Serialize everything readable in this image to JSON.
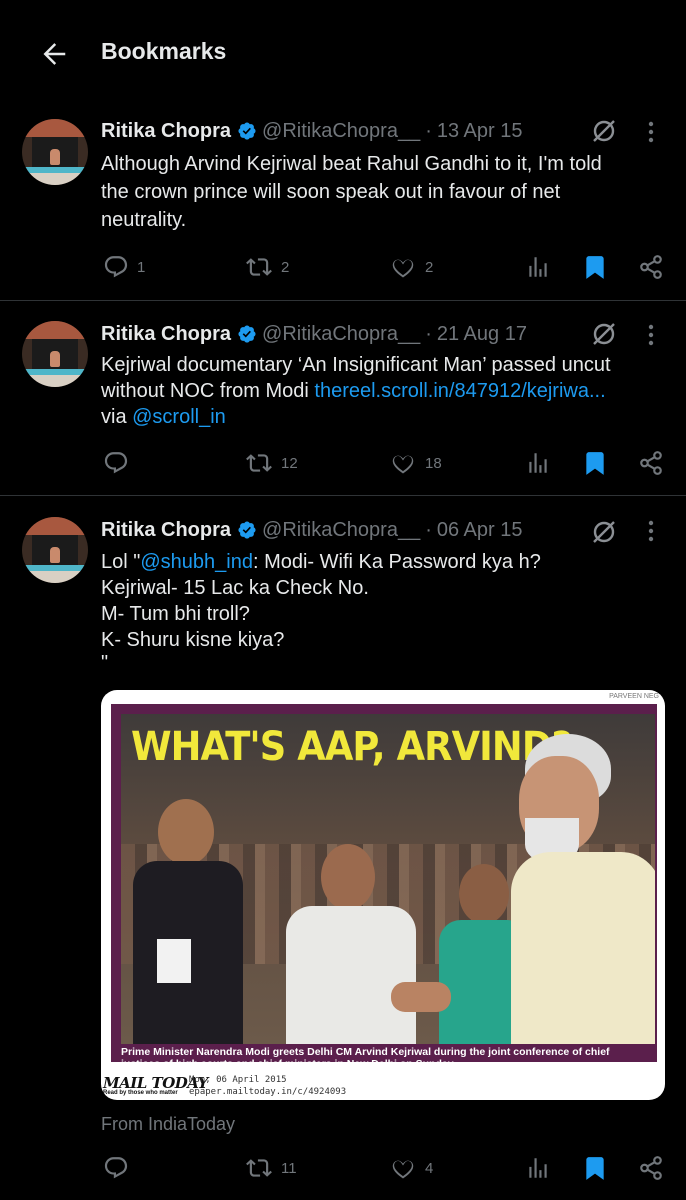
{
  "header": {
    "title": "Bookmarks"
  },
  "tweets": [
    {
      "name": "Ritika Chopra",
      "handle": "@RitikaChopra__",
      "dot": "·",
      "date": "13 Apr 15",
      "lines": [
        "Although Arvind Kejriwal beat Rahul Gandhi to it, I'm told",
        "the crown prince will soon speak out in favour of net",
        "neutrality."
      ],
      "replies": "1",
      "retweets": "2",
      "likes": "2"
    },
    {
      "name": "Ritika Chopra",
      "handle": "@RitikaChopra__",
      "dot": "·",
      "date": "21 Aug 17",
      "line1": "Kejriwal documentary ‘An Insignificant Man’ passed uncut",
      "line2_text": "without NOC from Modi ",
      "line2_link": "thereel.scroll.in/847912/kejriwa...",
      "line3_text": "via ",
      "line3_link": "@scroll_in",
      "replies": "",
      "retweets": "12",
      "likes": "18"
    },
    {
      "name": "Ritika Chopra",
      "handle": "@RitikaChopra__",
      "dot": "·",
      "date": "06 Apr 15",
      "line1_pre": "Lol \"",
      "line1_link": "@shubh_ind",
      "line1_post": ": Modi- Wifi Ka Password kya h?",
      "lines_rest": [
        "Kejriwal- 15 Lac ka Check No.",
        "M- Tum bhi troll?",
        "K- Shuru kisne kiya?",
        "\""
      ],
      "media": {
        "credit": "PARVEEN NEG",
        "headline": "WHAT'S AAP, ARVIND?",
        "caption": "Prime Minister Narendra Modi greets Delhi CM Arvind Kejriwal during the joint conference of chief justices of high courts and chief ministers in New Delhi on Sunday.",
        "logo": "MAIL TODAY",
        "tagline": "Read by those who matter",
        "paper_date": "Mon, 06 April 2015",
        "paper_url": "epaper.mailtoday.in/c/4924093"
      },
      "source": "From IndiaToday",
      "replies": "",
      "retweets": "11",
      "likes": "4"
    }
  ],
  "colors": {
    "accent": "#1d9bf0",
    "muted": "#71767b",
    "text": "#e7e9ea",
    "background": "#000000"
  },
  "icons": [
    "back-arrow-icon",
    "verified-badge-icon",
    "grok-icon",
    "more-icon",
    "reply-icon",
    "retweet-icon",
    "like-icon",
    "views-icon",
    "bookmark-icon",
    "share-icon"
  ]
}
